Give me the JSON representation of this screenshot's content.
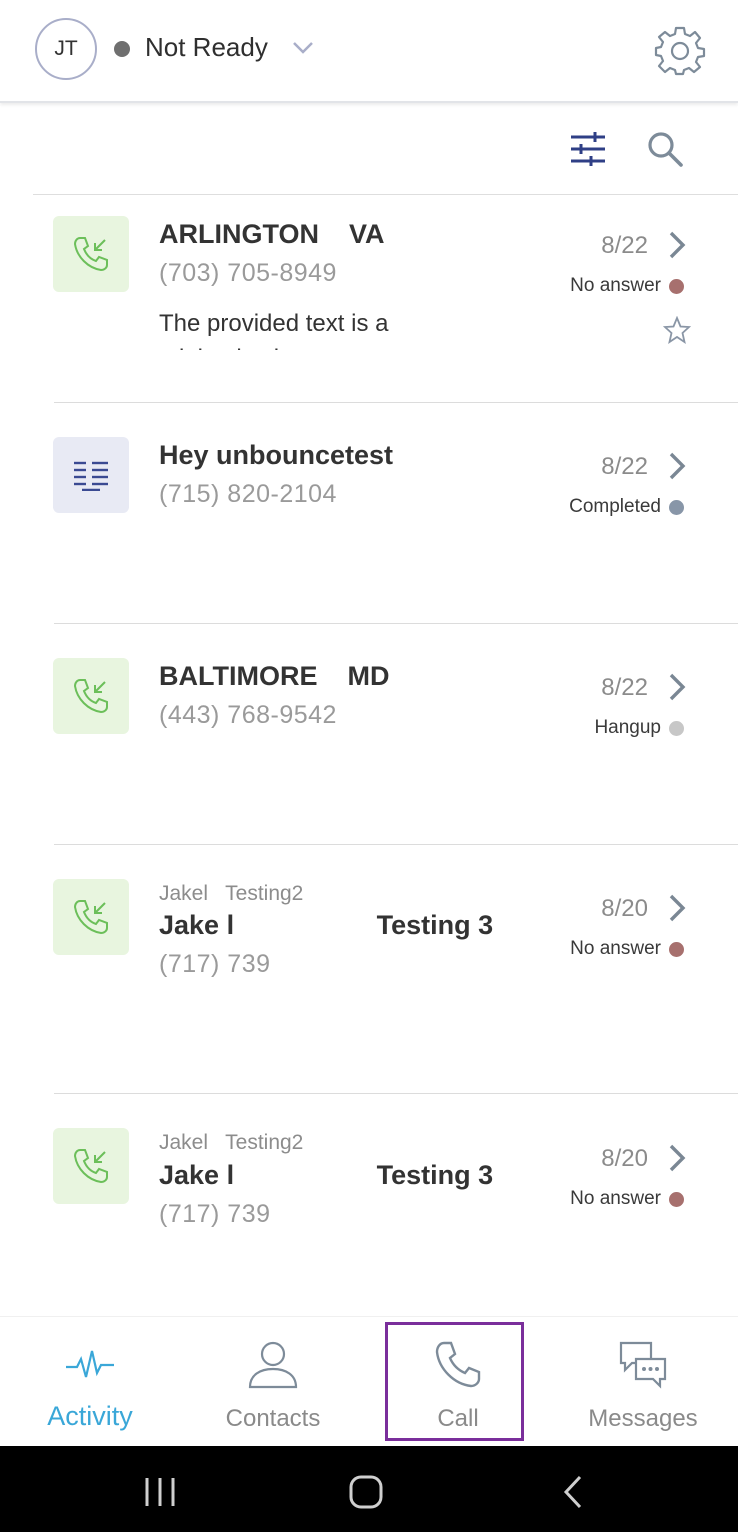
{
  "header": {
    "avatar_initials": "JT",
    "status": "Not Ready",
    "status_color": "#6f6f6f"
  },
  "activity": [
    {
      "type": "call",
      "title": "ARLINGTON    VA",
      "phone": "(703) 705-8949",
      "snippet": "The provided text is a minimal snippet:",
      "date": "8/22",
      "status": "No answer",
      "status_color": "#a7706e",
      "starred": false
    },
    {
      "type": "text",
      "title": "Hey unbouncetest",
      "phone": "(715) 820-2104",
      "date": "8/22",
      "status": "Completed",
      "status_color": "#8896a8"
    },
    {
      "type": "call",
      "title": "BALTIMORE    MD",
      "phone": "(443) 768-9542",
      "date": "8/22",
      "status": "Hangup",
      "status_color": "#c7c7c7"
    },
    {
      "type": "call",
      "subtitle": "Jakel   Testing2",
      "title": "Jake l                   Testing 3",
      "phone": "(717) 739",
      "date": "8/20",
      "status": "No answer",
      "status_color": "#a7706e"
    },
    {
      "type": "call",
      "subtitle": "Jakel   Testing2",
      "title": "Jake l                   Testing 3",
      "phone": "(717) 739",
      "date": "8/20",
      "status": "No answer",
      "status_color": "#a7706e"
    }
  ],
  "bottom_nav": {
    "items": [
      {
        "label": "Activity",
        "icon": "activity-pulse-icon",
        "active": true
      },
      {
        "label": "Contacts",
        "icon": "person-icon",
        "active": false
      },
      {
        "label": "Call",
        "icon": "phone-icon",
        "active": false
      },
      {
        "label": "Messages",
        "icon": "chat-bubbles-icon",
        "active": false
      }
    ],
    "active_color": "#3aa7d8",
    "highlight_color": "#7a2e9b"
  }
}
